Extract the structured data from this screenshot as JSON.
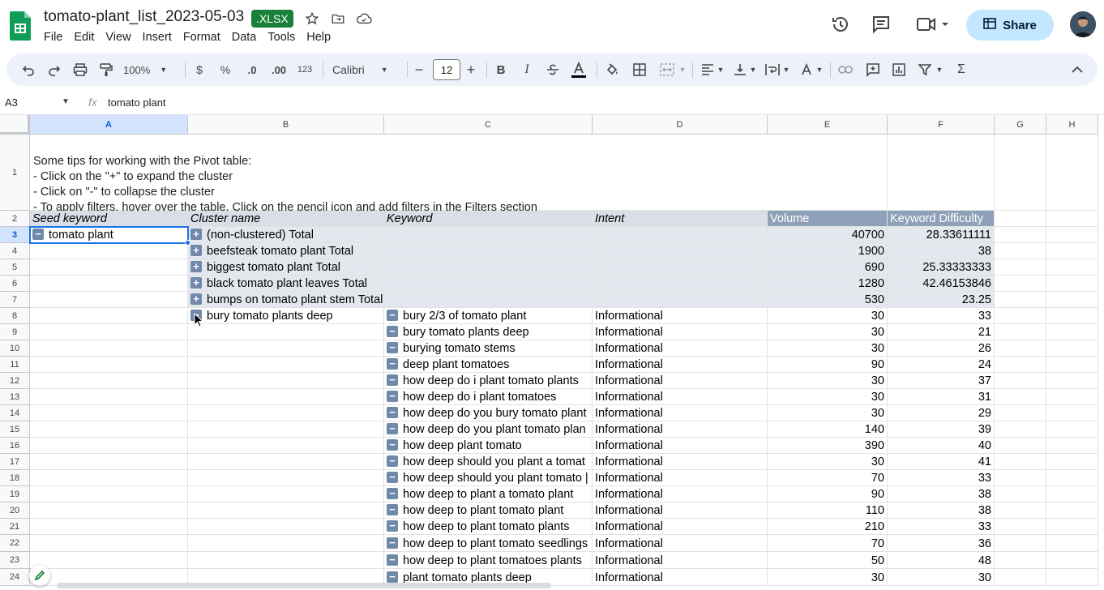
{
  "app": {
    "doc_title": "tomato-plant_list_2023-05-03",
    "file_badge": "XLSX",
    "menu": [
      "File",
      "Edit",
      "View",
      "Insert",
      "Format",
      "Data",
      "Tools",
      "Help"
    ],
    "share_label": "Share"
  },
  "toolbar": {
    "zoom": "100%",
    "currency": "$",
    "percent": "%",
    "dec_decrease": ".0",
    "dec_increase": ".00",
    "number_format": "123",
    "font": "Calibri",
    "font_size": "12",
    "minus": "−",
    "plus": "+"
  },
  "formula_bar": {
    "cell_ref": "A3",
    "fx": "fx",
    "value": "tomato plant"
  },
  "columns": [
    "A",
    "B",
    "C",
    "D",
    "E",
    "F",
    "G",
    "H"
  ],
  "rows": [
    "1",
    "2",
    "3",
    "4",
    "5",
    "6",
    "7",
    "8",
    "9",
    "10",
    "11",
    "12",
    "13",
    "14",
    "15",
    "16",
    "17",
    "18",
    "19",
    "20",
    "21",
    "22",
    "23",
    "24"
  ],
  "tips": [
    "Some tips for working with the Pivot table:",
    "- Click on the \"+\" to expand the cluster",
    "- Click on \"-\" to collapse the cluster",
    "- To apply filters, hover over the table. Click on the pencil icon and add filters in the Filters section"
  ],
  "table_header": {
    "seed": "Seed keyword",
    "cluster": "Cluster name",
    "keyword": "Keyword",
    "intent": "Intent",
    "volume": "Volume",
    "kd": "Keyword Difficulty"
  },
  "seed_keyword": "tomato plant",
  "totals": [
    {
      "cluster": "(non-clustered) Total",
      "volume": "40700",
      "kd": "28.33611111"
    },
    {
      "cluster": "beefsteak tomato plant Total",
      "volume": "1900",
      "kd": "38"
    },
    {
      "cluster": "biggest tomato plant Total",
      "volume": "690",
      "kd": "25.33333333"
    },
    {
      "cluster": "black tomato plant leaves Total",
      "volume": "1280",
      "kd": "42.46153846"
    },
    {
      "cluster": "bumps on tomato plant stem Total",
      "volume": "530",
      "kd": "23.25"
    }
  ],
  "expanded_cluster": "bury tomato plants deep",
  "keywords": [
    {
      "keyword": "bury 2/3 of tomato plant",
      "intent": "Informational",
      "volume": "30",
      "kd": "33"
    },
    {
      "keyword": "bury tomato plants deep",
      "intent": "Informational",
      "volume": "30",
      "kd": "21"
    },
    {
      "keyword": "burying tomato stems",
      "intent": "Informational",
      "volume": "30",
      "kd": "26"
    },
    {
      "keyword": "deep plant tomatoes",
      "intent": "Informational",
      "volume": "90",
      "kd": "24"
    },
    {
      "keyword": "how deep do i plant tomato plants",
      "intent": "Informational",
      "volume": "30",
      "kd": "37"
    },
    {
      "keyword": "how deep do i plant tomatoes",
      "intent": "Informational",
      "volume": "30",
      "kd": "31"
    },
    {
      "keyword": "how deep do you bury tomato plant",
      "intent": "Informational",
      "volume": "30",
      "kd": "29"
    },
    {
      "keyword": "how deep do you plant tomato plan",
      "intent": "Informational",
      "volume": "140",
      "kd": "39"
    },
    {
      "keyword": "how deep plant tomato",
      "intent": "Informational",
      "volume": "390",
      "kd": "40"
    },
    {
      "keyword": "how deep should you plant a tomat",
      "intent": "Informational",
      "volume": "30",
      "kd": "41"
    },
    {
      "keyword": "how deep should you plant tomato |",
      "intent": "Informational",
      "volume": "70",
      "kd": "33"
    },
    {
      "keyword": "how deep to plant a tomato plant",
      "intent": "Informational",
      "volume": "90",
      "kd": "38"
    },
    {
      "keyword": "how deep to plant tomato plant",
      "intent": "Informational",
      "volume": "110",
      "kd": "38"
    },
    {
      "keyword": "how deep to plant tomato plants",
      "intent": "Informational",
      "volume": "210",
      "kd": "33"
    },
    {
      "keyword": "how deep to plant tomato seedlings",
      "intent": "Informational",
      "volume": "70",
      "kd": "36"
    },
    {
      "keyword": "how deep to plant tomatoes plants",
      "intent": "Informational",
      "volume": "50",
      "kd": "48"
    },
    {
      "keyword": "plant tomato plants deep",
      "intent": "Informational",
      "volume": "30",
      "kd": "30"
    }
  ],
  "colors": {
    "header_bg": "#d9dee7",
    "header_dark_bg": "#8ea1b8",
    "total_bg": "#e3e8ef",
    "toggle": "#7089a8",
    "share_bg": "#c2e7ff",
    "selection": "#1a73e8"
  },
  "icons": [
    "sheets-logo-icon",
    "star-icon",
    "move-folder-icon",
    "cloud-status-icon",
    "history-icon",
    "comment-icon",
    "meet-icon",
    "lock-icon",
    "undo-icon",
    "redo-icon",
    "print-icon",
    "paint-format-icon",
    "bold-icon",
    "italic-icon",
    "strikethrough-icon",
    "text-color-icon",
    "fill-color-icon",
    "borders-icon",
    "merge-icon",
    "align-icon",
    "valign-icon",
    "wrap-icon",
    "rotate-icon",
    "link-icon",
    "insert-comment-icon",
    "chart-icon",
    "filter-icon",
    "functions-icon",
    "collapse-icon",
    "explore-icon"
  ]
}
